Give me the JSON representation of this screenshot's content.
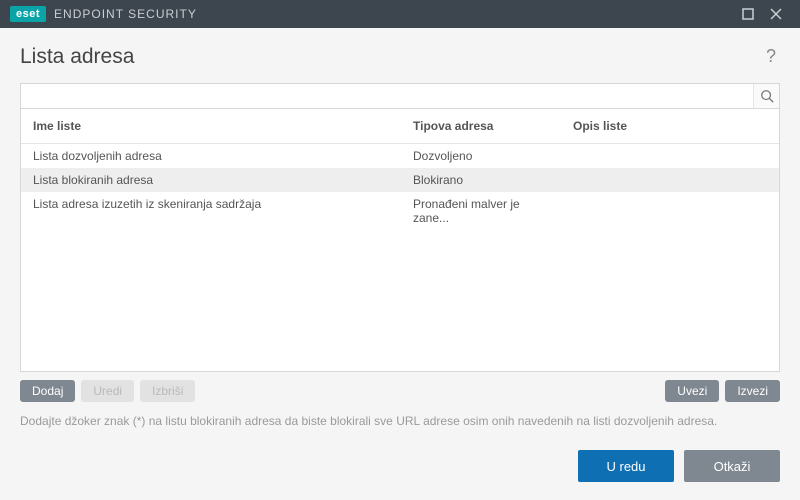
{
  "titlebar": {
    "logo": "eset",
    "app_name": "ENDPOINT SECURITY"
  },
  "header": {
    "title": "Lista adresa"
  },
  "search": {
    "value": ""
  },
  "table": {
    "columns": [
      "Ime liste",
      "Tipova adresa",
      "Opis liste"
    ],
    "rows": [
      {
        "name": "Lista dozvoljenih adresa",
        "type": "Dozvoljeno",
        "desc": "",
        "selected": false
      },
      {
        "name": "Lista blokiranih adresa",
        "type": "Blokirano",
        "desc": "",
        "selected": true
      },
      {
        "name": "Lista adresa izuzetih iz skeniranja sadržaja",
        "type": "Pronađeni malver je zane...",
        "desc": "",
        "selected": false
      }
    ]
  },
  "actions": {
    "add": "Dodaj",
    "edit": "Uredi",
    "delete": "Izbriši",
    "import": "Uvezi",
    "export": "Izvezi"
  },
  "hint": "Dodajte džoker znak (*) na listu blokiranih adresa da biste blokirali sve URL adrese osim onih navedenih na listi dozvoljenih adresa.",
  "footer": {
    "ok": "U redu",
    "cancel": "Otkaži"
  }
}
